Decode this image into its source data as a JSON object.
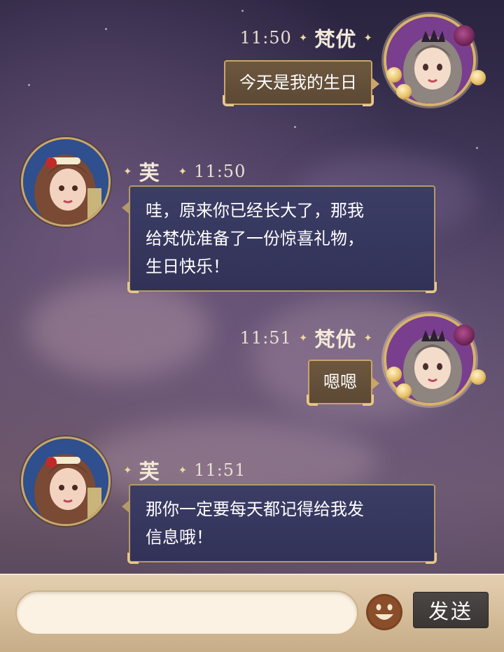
{
  "messages": [
    {
      "side": "right",
      "sender": "梵优",
      "time": "11:50",
      "text": "今天是我的生日"
    },
    {
      "side": "left",
      "sender": "芙",
      "time": "11:50",
      "lines": [
        "哇，原来你已经长大了，那我",
        "给梵优准备了一份惊喜礼物，",
        "生日快乐！"
      ]
    },
    {
      "side": "right",
      "sender": "梵优",
      "time": "11:51",
      "text": "嗯嗯"
    },
    {
      "side": "left",
      "sender": "芙",
      "time": "11:51",
      "lines": [
        "那你一定要每天都记得给我发",
        "信息哦！"
      ]
    }
  ],
  "input": {
    "placeholder": "",
    "value": ""
  },
  "send_label": "发送",
  "colors": {
    "right_bubble": "#5c4934",
    "left_bubble": "#323257",
    "accent_gold": "#caa56a",
    "send_button": "#3a3634"
  },
  "icons": {
    "emoji": "smiley-face-icon",
    "separator": "sparkle-icon"
  }
}
